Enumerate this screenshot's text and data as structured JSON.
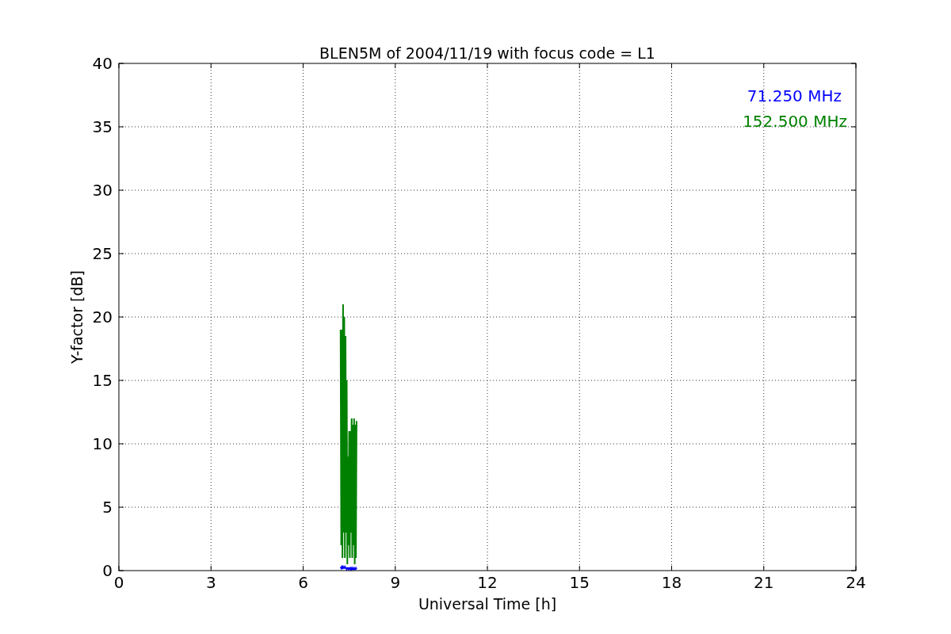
{
  "chart_data": {
    "type": "line",
    "title": "BLEN5M of 2004/11/19 with focus code = L1",
    "xlabel": "Universal Time [h]",
    "ylabel": "Y-factor [dB]",
    "x": [
      7.22,
      7.24,
      7.26,
      7.28,
      7.3,
      7.32,
      7.34,
      7.36,
      7.38,
      7.4,
      7.42,
      7.44,
      7.46,
      7.48,
      7.5,
      7.52,
      7.54,
      7.56,
      7.58,
      7.6,
      7.62,
      7.64,
      7.66,
      7.68,
      7.7,
      7.72,
      7.74
    ],
    "series": [
      {
        "name": "71.250 MHz",
        "color": "#0000ff",
        "values": [
          0.3,
          0.2,
          0.3,
          0.2,
          0.3,
          0.2,
          0.2,
          0.3,
          0.2,
          0.2,
          0.1,
          0.2,
          0.2,
          0.1,
          0.2,
          0.2,
          0.1,
          0.2,
          0.1,
          0.2,
          0.1,
          0.1,
          0.2,
          0.1,
          0.1,
          0.2,
          0.1
        ]
      },
      {
        "name": "152.500 MHz",
        "color": "#008000",
        "values": [
          19,
          2,
          19,
          1,
          21,
          3,
          20,
          1,
          18.5,
          3,
          15,
          0.5,
          9,
          2,
          11,
          1,
          11,
          3,
          12,
          1,
          11.5,
          2,
          12,
          0.5,
          11.5,
          1,
          11.8
        ]
      }
    ],
    "xlim": [
      0,
      24
    ],
    "ylim": [
      0,
      40
    ],
    "xticks": [
      0,
      3,
      6,
      9,
      12,
      15,
      18,
      21,
      24
    ],
    "yticks": [
      0,
      5,
      10,
      15,
      20,
      25,
      30,
      35,
      40
    ],
    "grid": true
  }
}
